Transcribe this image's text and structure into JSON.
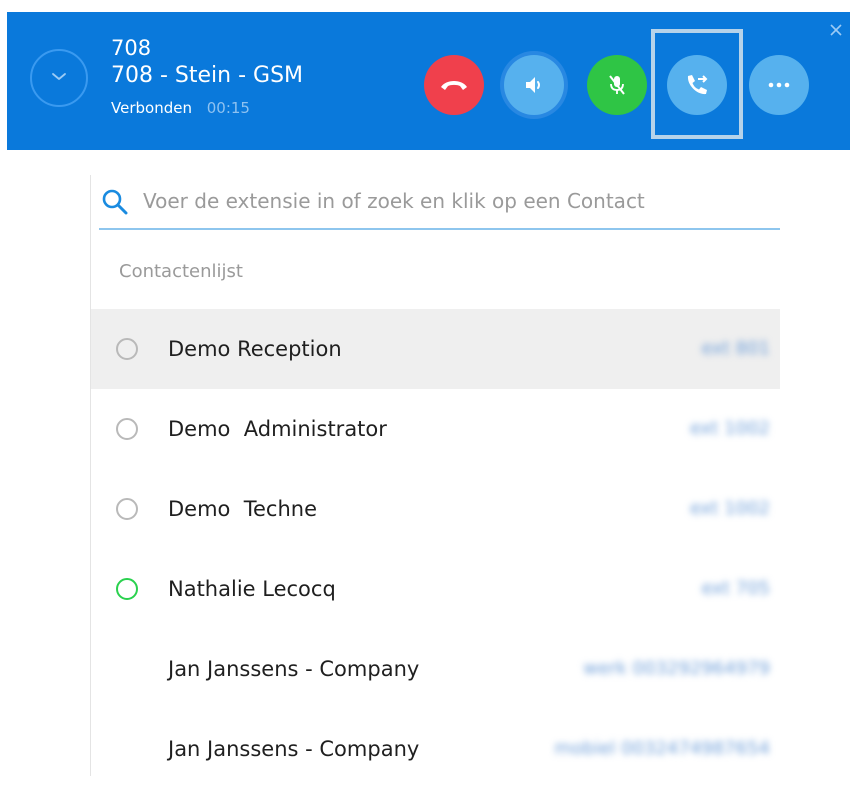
{
  "call": {
    "number": "708",
    "caller": "708 - Stein - GSM",
    "status": "Verbonden",
    "timer": "00:15",
    "controls": [
      {
        "id": "hangup",
        "icon": "phone-hangup-icon",
        "color": "#f0404c"
      },
      {
        "id": "speaker",
        "icon": "speaker-icon",
        "color": "#56b1ee"
      },
      {
        "id": "mute",
        "icon": "microphone-muted-icon",
        "color": "#2fc545"
      },
      {
        "id": "transfer",
        "icon": "call-transfer-icon",
        "color": "#56b1ee",
        "highlighted": true
      },
      {
        "id": "more",
        "icon": "more-dots-icon",
        "color": "#56b1ee"
      }
    ]
  },
  "search": {
    "placeholder": "Voer de extensie in of zoek en klik op een Contact",
    "value": ""
  },
  "contacts": {
    "title": "Contactenlijst",
    "items": [
      {
        "name": "Demo Reception",
        "ext": "ext 801",
        "status": "offline",
        "selected": true
      },
      {
        "name": "Demo  Administrator",
        "ext": "ext 1002",
        "status": "offline"
      },
      {
        "name": "Demo  Techne",
        "ext": "ext 1002",
        "status": "offline"
      },
      {
        "name": "Nathalie Lecocq",
        "ext": "ext 705",
        "status": "online"
      },
      {
        "name": "Jan Janssens - Company",
        "ext": "werk 003292964979",
        "status": "none"
      },
      {
        "name": "Jan Janssens - Company",
        "ext": "mobiel 0032474987654",
        "status": "none"
      }
    ]
  },
  "colors": {
    "header": "#0a79db",
    "accent": "#0a79db",
    "online": "#2ad14e",
    "offline": "#b9b9b9"
  }
}
